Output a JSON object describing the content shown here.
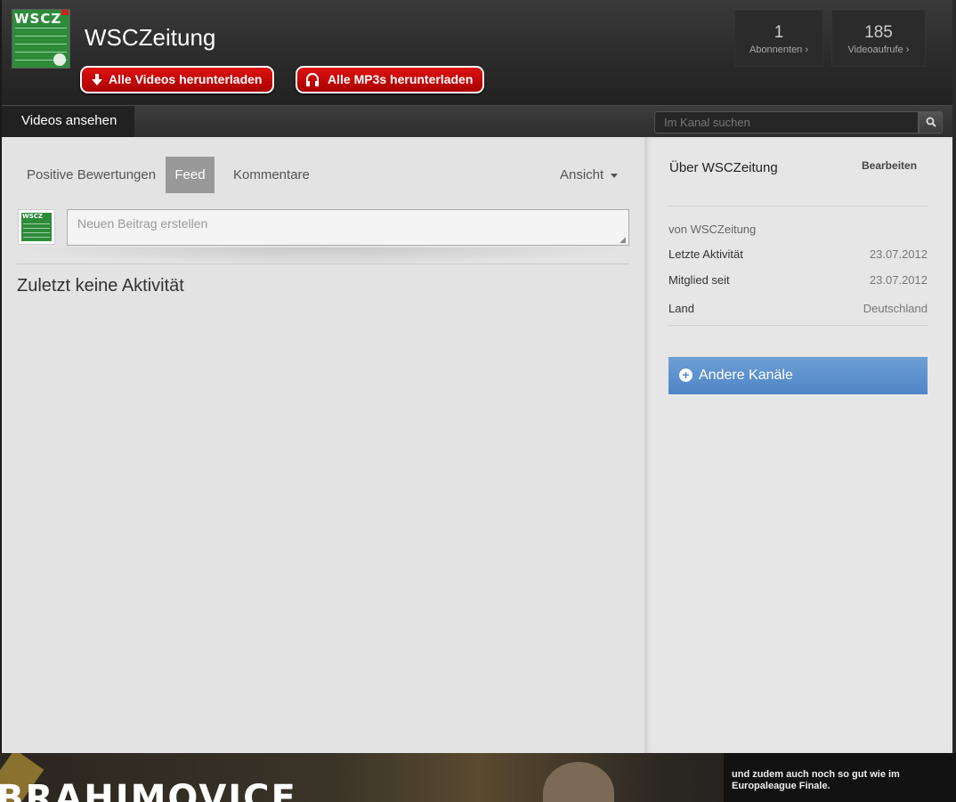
{
  "channel": {
    "name": "WSCZeitung",
    "logo_text": "WSCZ"
  },
  "header": {
    "download_videos_label": "Alle Videos herunterladen",
    "download_mp3_label": "Alle MP3s herunterladen",
    "stats": {
      "subscribers_count": "1",
      "subscribers_label": "Abonnenten ›",
      "views_count": "185",
      "views_label": "Videoaufrufe ›"
    }
  },
  "nav": {
    "active_tab": "Videos ansehen",
    "search_placeholder": "Im Kanal suchen"
  },
  "feed": {
    "tabs": [
      {
        "label": "Positive Bewertungen",
        "active": false
      },
      {
        "label": "Feed",
        "active": true
      },
      {
        "label": "Kommentare",
        "active": false
      }
    ],
    "view_label": "Ansicht",
    "post_placeholder": "Neuen Beitrag erstellen",
    "empty_message": "Zuletzt keine Aktivität"
  },
  "sidebar": {
    "about_title": "Über WSCZeitung",
    "edit_label": "Bearbeiten",
    "by_line": "von WSCZeitung",
    "rows": [
      {
        "label": "Letzte Aktivität",
        "value": "23.07.2012"
      },
      {
        "label": "Mitglied seit",
        "value": "23.07.2012"
      },
      {
        "label": "Land",
        "value": "Deutschland"
      }
    ],
    "other_channels_label": "Andere Kanäle"
  },
  "banner": {
    "title": "BRAHIMOVICE",
    "text": "und zudem auch noch so gut wie im Europaleague Finale."
  },
  "colors": {
    "download_button": "#cc1111",
    "other_channels_button": "#5a8fcc",
    "feed_active_tab": "#999999"
  }
}
